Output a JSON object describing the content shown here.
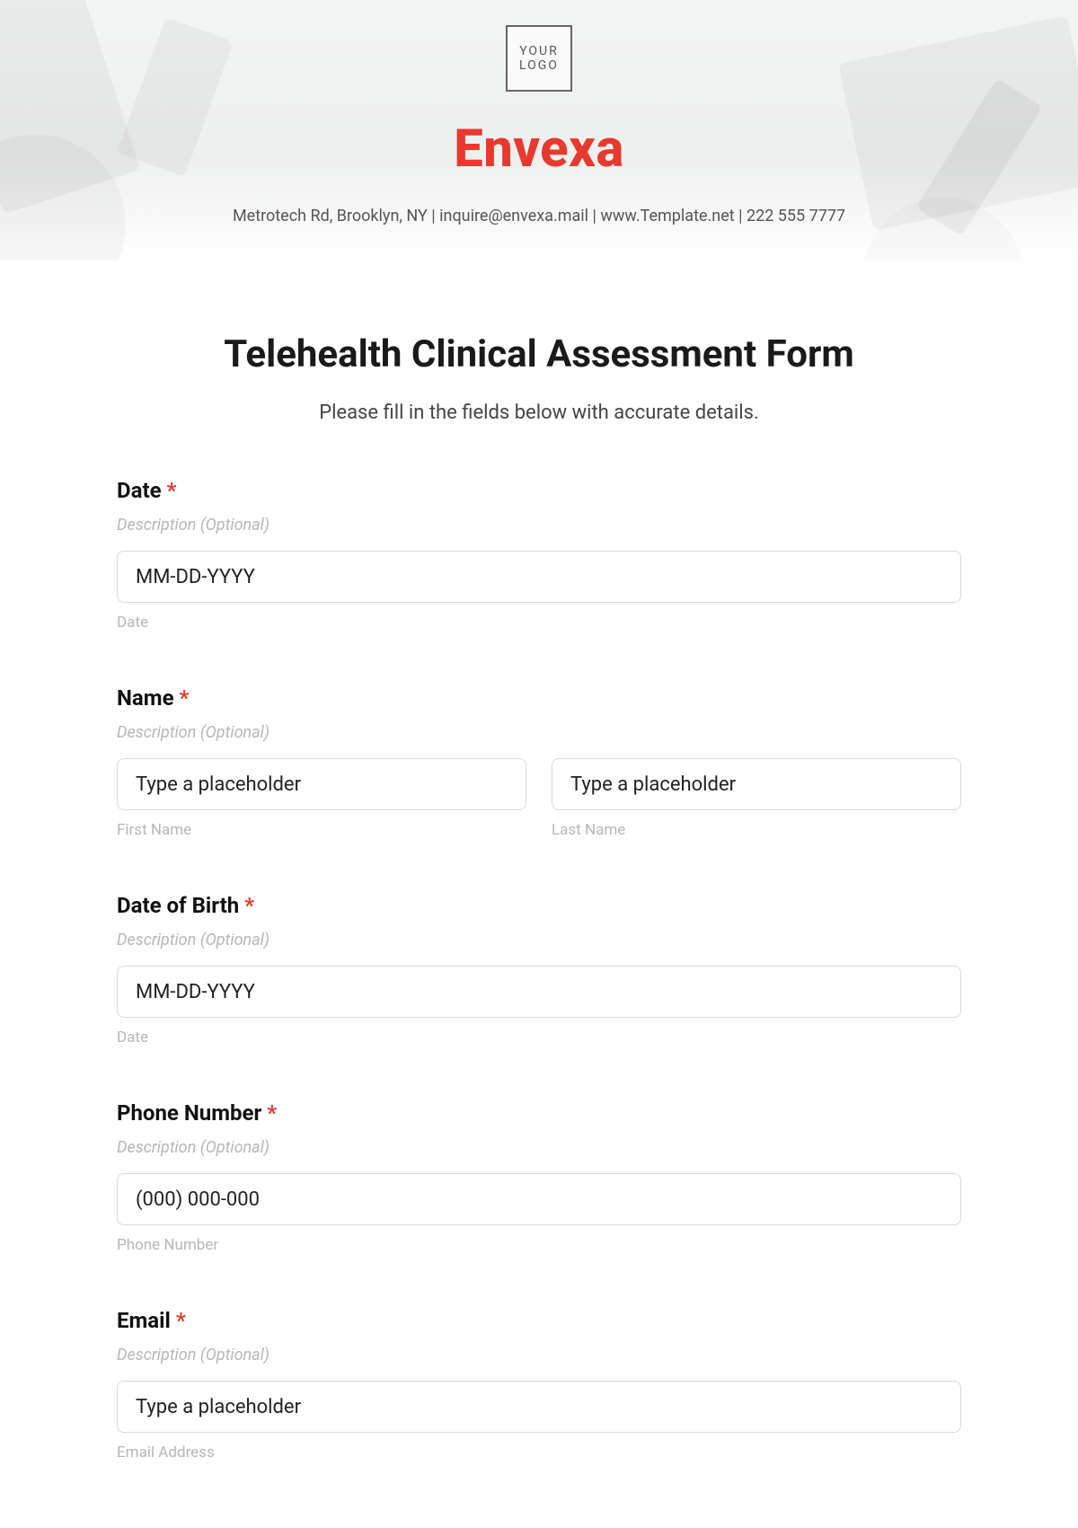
{
  "header": {
    "logo_text": "YOUR\nLOGO",
    "brand": "Envexa",
    "contact_line": "Metrotech Rd, Brooklyn, NY  |  inquire@envexa.mail | www.Template.net  |  222 555 7777"
  },
  "form": {
    "title": "Telehealth Clinical Assessment Form",
    "subtitle": "Please fill in the fields below with accurate details.",
    "desc_placeholder": "Description (Optional)",
    "fields": {
      "date": {
        "label": "Date",
        "required": "*",
        "placeholder": "MM-DD-YYYY",
        "sub": "Date"
      },
      "name": {
        "label": "Name",
        "required": "*",
        "first_placeholder": "Type a placeholder",
        "first_sub": "First Name",
        "last_placeholder": "Type a placeholder",
        "last_sub": "Last Name"
      },
      "dob": {
        "label": "Date of Birth",
        "required": "*",
        "placeholder": "MM-DD-YYYY",
        "sub": "Date"
      },
      "phone": {
        "label": "Phone Number",
        "required": "*",
        "placeholder": "(000) 000-000",
        "sub": "Phone Number"
      },
      "email": {
        "label": "Email",
        "required": "*",
        "placeholder": "Type a placeholder",
        "sub": "Email Address"
      }
    }
  }
}
